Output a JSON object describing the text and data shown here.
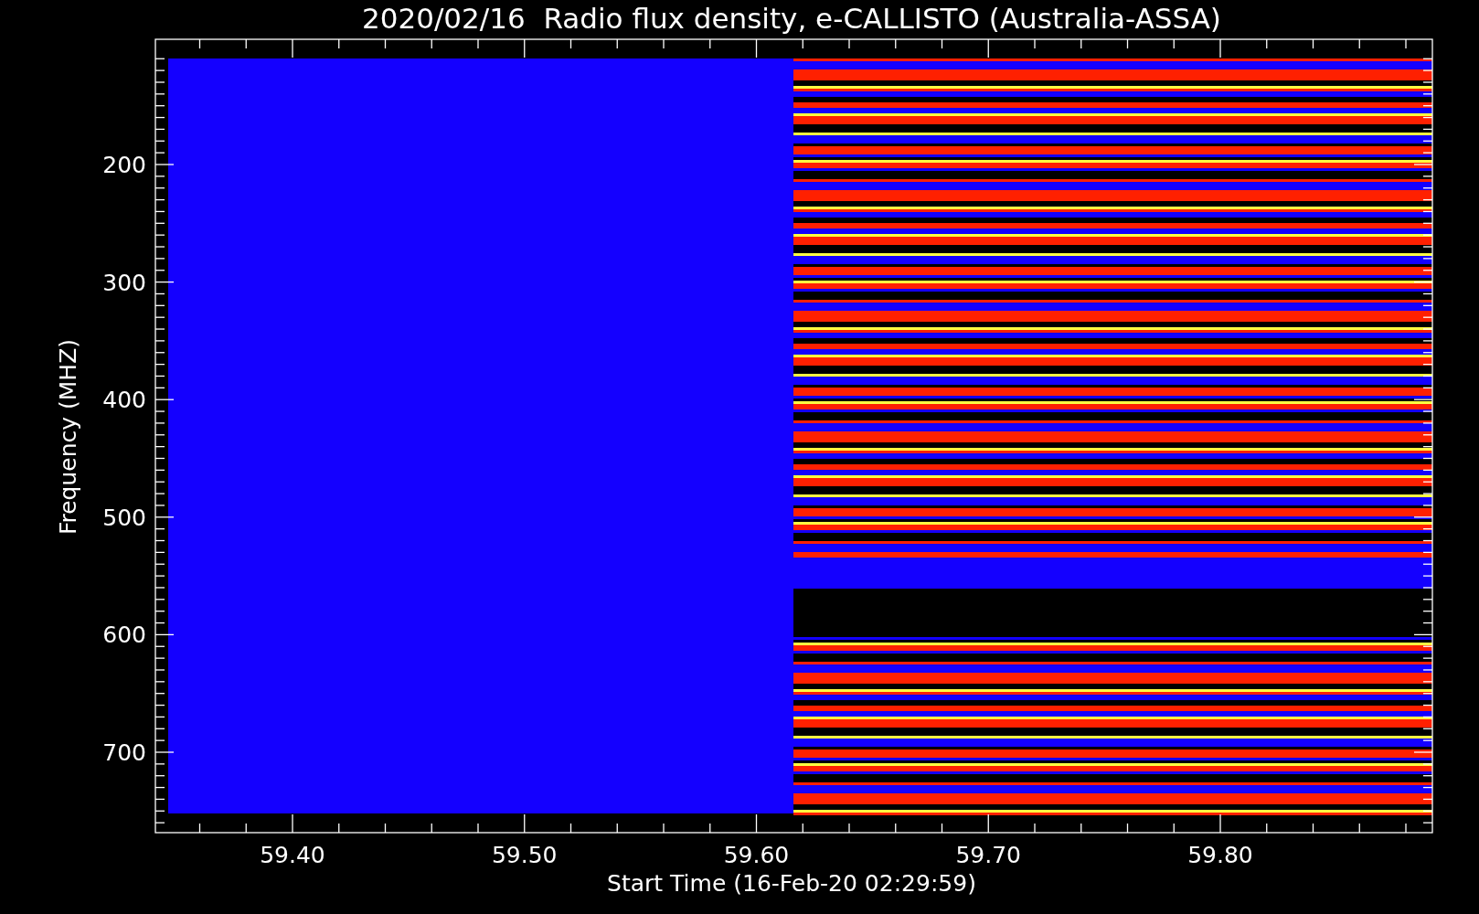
{
  "title": "2020/02/16  Radio flux density, e-CALLISTO (Australia-ASSA)",
  "y_axis": {
    "label": "Frequency (MHZ)",
    "tick_labels": [
      "200",
      "300",
      "400",
      "500",
      "600",
      "700"
    ]
  },
  "x_axis": {
    "label": "Start Time (16-Feb-20 02:29:59)",
    "tick_labels": [
      "59.40",
      "59.50",
      "59.60",
      "59.70",
      "59.80"
    ]
  }
}
